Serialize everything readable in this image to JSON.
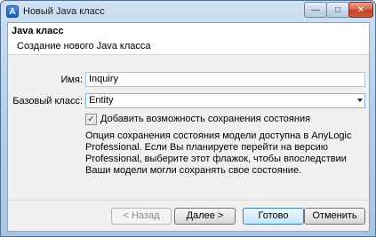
{
  "window": {
    "title": "Новый Java класс",
    "app_icon_letter": "A",
    "controls": {
      "minimize": "—",
      "maximize": "□",
      "close": "✕"
    }
  },
  "header": {
    "title": "Java класс",
    "subtitle": "Создание нового Java класса"
  },
  "form": {
    "name_label": "Имя:",
    "name_value": "Inquiry",
    "base_label": "Базовый класс:",
    "base_value": "Entity",
    "checkbox_checked": true,
    "checkbox_mark": "✓",
    "checkbox_label": "Добавить возможность сохранения состояния",
    "description": "Опция сохранения состояния модели доступна в AnyLogic Professional. Если Вы планируете перейти на версию Professional, выберите этот флажок, чтобы впоследствии Ваши модели могли сохранять свое состояние."
  },
  "buttons": {
    "back": "< Назад",
    "next": "Далее >",
    "finish": "Готово",
    "cancel": "Отменить"
  },
  "colors": {
    "title_gradient_top": "#cfe0f1",
    "close_button": "#c0402a",
    "default_button": "#bee6fd"
  }
}
